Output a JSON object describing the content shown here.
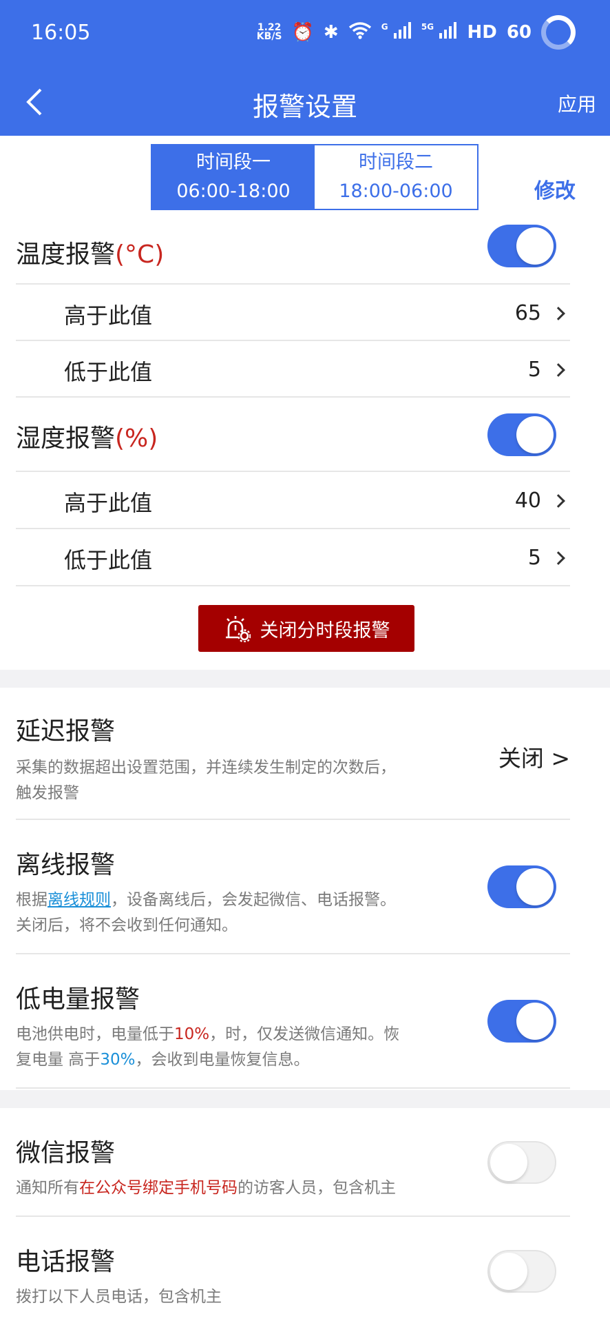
{
  "status_bar": {
    "time": "16:05",
    "net_speed_top": "1.22",
    "net_speed_bottom": "KB/S",
    "signal_1": "G",
    "signal_2": "5G",
    "hd": "HD",
    "battery": "60"
  },
  "header": {
    "title": "报警设置",
    "apply_label": "应用",
    "back_icon": "chevron-left-icon"
  },
  "segments": {
    "seg1": {
      "name": "时间段一",
      "range": "06:00-18:00",
      "active": true
    },
    "seg2": {
      "name": "时间段二",
      "range": "18:00-06:00",
      "active": false
    },
    "modify_label": "修改"
  },
  "temperature": {
    "title": "温度报警",
    "unit": "(°C)",
    "enabled": true,
    "high_label": "高于此值",
    "high_value": "65",
    "low_label": "低于此值",
    "low_value": "5"
  },
  "humidity": {
    "title": "湿度报警",
    "unit": "(%)",
    "enabled": true,
    "high_label": "高于此值",
    "high_value": "40",
    "low_label": "低于此值",
    "low_value": "5"
  },
  "close_segment_button": "关闭分时段报警",
  "delay": {
    "title": "延迟报警",
    "desc_line1": "采集的数据超出设置范围，并连续发生制定的次数后，",
    "desc_line2": "触发报警",
    "value": "关闭 >"
  },
  "offline": {
    "title": "离线报警",
    "desc_pre": "根据",
    "desc_link": "离线规则",
    "desc_post": "，设备离线后，会发起微信、电话报警。",
    "desc_line2": "关闭后，将不会收到任何通知。",
    "enabled": true
  },
  "low_battery": {
    "title": "低电量报警",
    "desc_a": "电池供电时，电量低于",
    "desc_red": "10%",
    "desc_b": "，时，仅发送微信通知。恢",
    "desc_c": "复电量 高于",
    "desc_blue": "30%",
    "desc_d": "，会收到电量恢复信息。",
    "enabled": true
  },
  "wechat": {
    "title": "微信报警",
    "desc_a": "通知所有",
    "desc_red": "在公众号绑定手机号码",
    "desc_b": "的访客人员，包含机主",
    "enabled": false
  },
  "phone": {
    "title": "电话报警",
    "desc": "拨打以下人员电话，包含机主",
    "enabled": false
  },
  "colors": {
    "primary": "#3d6fe8",
    "danger_button": "#a40000",
    "unit_red": "#c8261f",
    "link_blue": "#1a8fd8"
  }
}
